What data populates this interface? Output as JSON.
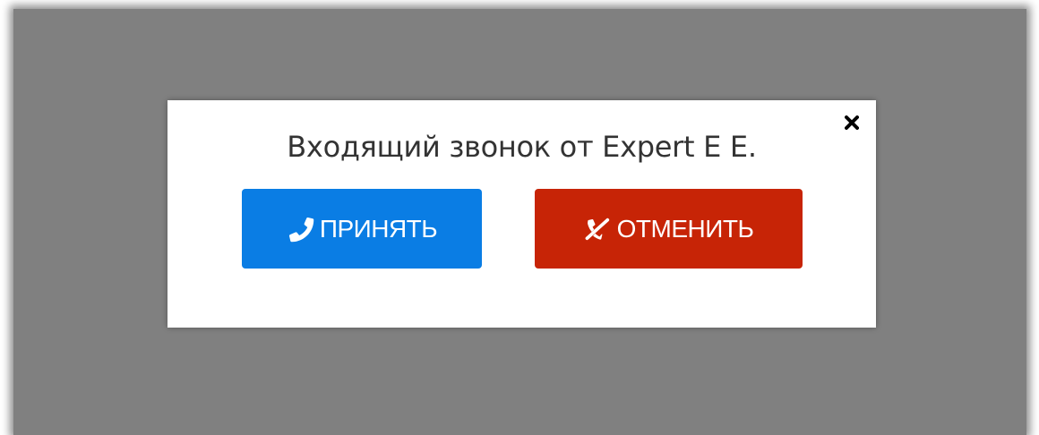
{
  "dialog": {
    "title": "Входящий звонок от Expert E E.",
    "close_icon": "close-icon"
  },
  "actions": {
    "accept_label": "ПРИНЯТЬ",
    "accept_icon": "phone-icon",
    "decline_label": "ОТМЕНИТЬ",
    "decline_icon": "phone-slash-icon"
  },
  "colors": {
    "overlay": "#808080",
    "accept": "#0a7de4",
    "decline": "#c72406",
    "title_text": "#333333"
  }
}
